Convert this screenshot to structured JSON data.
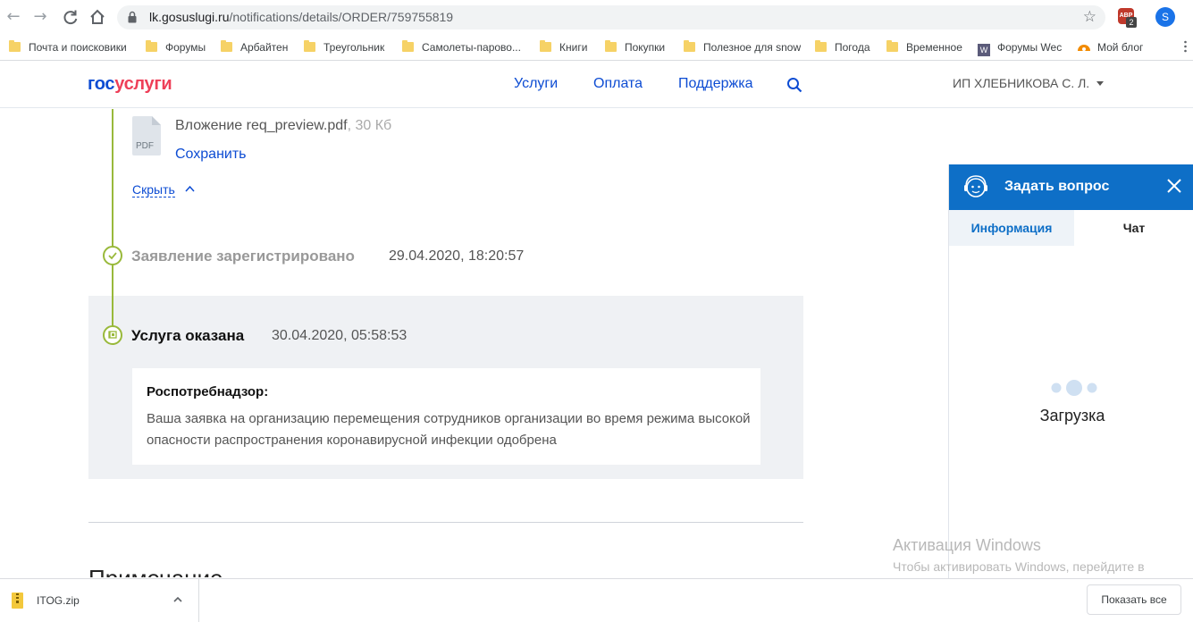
{
  "browser": {
    "url_domain": "lk.gosuslugi.ru",
    "url_path": "/notifications/details/ORDER/759755819",
    "adblock_count": "2",
    "profile_initial": "S",
    "bookmarks": [
      {
        "label": "Почта и поисковики",
        "icon": "folder-icon"
      },
      {
        "label": "Форумы",
        "icon": "folder-icon"
      },
      {
        "label": "Арбайтен",
        "icon": "folder-icon"
      },
      {
        "label": "Треугольник",
        "icon": "folder-icon"
      },
      {
        "label": "Самолеты-парово...",
        "icon": "folder-icon"
      },
      {
        "label": "Книги",
        "icon": "folder-icon"
      },
      {
        "label": "Покупки",
        "icon": "folder-icon"
      },
      {
        "label": "Полезное для snow",
        "icon": "folder-icon"
      },
      {
        "label": "Погода",
        "icon": "folder-icon"
      },
      {
        "label": "Временное",
        "icon": "folder-icon"
      },
      {
        "label": "Форумы Wec",
        "icon": "w-site-icon"
      },
      {
        "label": "Мой блог",
        "icon": "blog-icon"
      }
    ]
  },
  "site": {
    "logo_part1": "гос",
    "logo_part2": "услуги",
    "nav": [
      "Услуги",
      "Оплата",
      "Поддержка"
    ],
    "user": "ИП ХЛЕБНИКОВА С. Л."
  },
  "attachment": {
    "type_label": "PDF",
    "name": "Вложение req_preview.pdf",
    "size": ", 30 Кб",
    "save_label": "Сохранить",
    "hide_label": "Скрыть"
  },
  "timeline": [
    {
      "title": "Заявление зарегистрировано",
      "date": "29.04.2020, 18:20:57"
    },
    {
      "title": "Услуга оказана",
      "date": "30.04.2020, 05:58:53"
    }
  ],
  "message": {
    "org": "Роспотребнадзор:",
    "text": "Ваша заявка на организацию перемещения сотрудников организации во время режима высокой опасности распространения коронавирусной инфекции одобрена"
  },
  "section_heading": "Примечание",
  "chat": {
    "title": "Задать вопрос",
    "tab_info": "Информация",
    "tab_chat": "Чат",
    "loading": "Загрузка"
  },
  "watermark": {
    "title": "Активация Windows",
    "text": "Чтобы активировать Windows, перейдите в раздел \"Параметры\"."
  },
  "downloads": {
    "file": "ITOG.zip",
    "show_all": "Показать все"
  },
  "colors": {
    "brand_blue": "#0d4cd3",
    "brand_red": "#ee3f58",
    "timeline_green": "#99b93b",
    "chat_blue": "#0e6fc7"
  }
}
